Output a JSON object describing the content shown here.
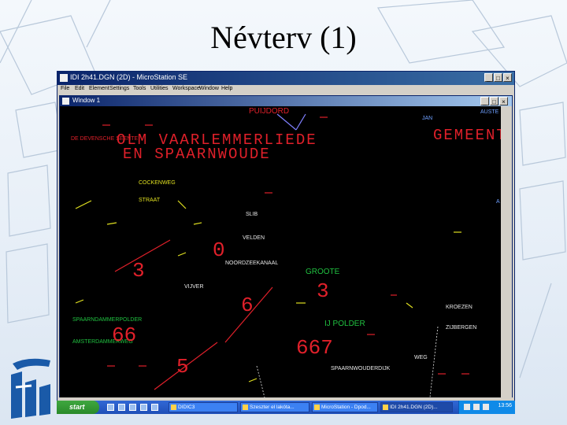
{
  "slide": {
    "title": "Névterv (1)"
  },
  "app": {
    "title": "IDI 2h41.DGN (2D) - MicroStation SE",
    "menu": [
      "File",
      "Edit",
      "Element",
      "Settings",
      "Tools",
      "Utilities",
      "Workspace",
      "Window",
      "Help"
    ],
    "window_buttons": [
      "_",
      "□",
      "×"
    ]
  },
  "sub_window": {
    "title": "Window 1",
    "buttons": [
      "_",
      "□",
      "×"
    ]
  },
  "map_labels": {
    "red_large_1": "OLM  VAARLEMMERLIEDE",
    "red_large_2": "EN  SPAARNWOUDE",
    "red_right": "GEMEENT",
    "red_top": "PUIJDORD",
    "red_sp1": "DE DEVENSCHE SEENTE",
    "yellow_1": "COCKENWEG",
    "yellow_2": "STRAAT",
    "white_1": "SLIB",
    "white_2": "VELDEN",
    "white_3": "VIJVER",
    "white_4": "NOORDZEEKANAAL",
    "white_5": "KROEZEN",
    "white_6": "ZIJBERGEN",
    "white_7": "SPAARNWOUDERDIJK",
    "white_8": "WEG",
    "green_1": "GROOTE",
    "green_2": "IJ POLDER",
    "green_3": "SPAARNDAMMERPOLDER",
    "green_4": "AMSTERDAMMERWEG",
    "blue_1": "AUSTE",
    "blue_2": "JAN",
    "blue_3": "A",
    "num_1": "3",
    "num_2": "0",
    "num_3": "3",
    "num_4": "66",
    "num_5": "667",
    "num_6": "5",
    "num_7": "6"
  },
  "taskbar": {
    "start_label": "start",
    "tasks": [
      "DIDIC3",
      "Szeszter el lakóta...",
      "MicroStation - Dpod...",
      "IDI 2h41.DGN (2D)..."
    ],
    "clock": "13:56"
  }
}
